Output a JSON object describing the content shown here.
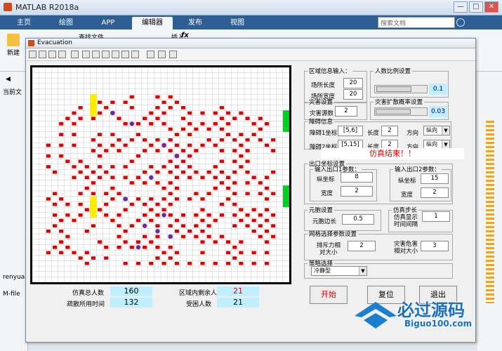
{
  "app": {
    "title": "MATLAB R2018a",
    "window_buttons": [
      "—",
      "□",
      "✕"
    ],
    "tabs": [
      "主页",
      "绘图",
      "APP",
      "编辑器",
      "发布",
      "视图"
    ],
    "active_tab": 3,
    "search_placeholder": "搜索文档",
    "toolbar": {
      "new_label": "新建",
      "find_files": "查找文件",
      "insert_label": "插入",
      "fx": "fx"
    },
    "left_labels": {
      "current_folder": "当前文",
      "workspace": "renyua",
      "mfile": "M-file"
    }
  },
  "figure": {
    "title": "Evacuation",
    "left_info": {
      "total_people_label": "仿真总人数",
      "total_people": "160",
      "time_label": "疏散所用时间",
      "time": "132",
      "remaining_label": "区域内剩余人数",
      "remaining": "21",
      "trapped_label": "受困人数",
      "trapped": "21"
    },
    "area": {
      "legend": "区域信息输入：",
      "len_label": "场所长度",
      "len": "20",
      "wid_label": "场所宽度",
      "wid": "20"
    },
    "ratio": {
      "legend": "人数比例设置",
      "value": "0.1",
      "level": 0.1
    },
    "disaster": {
      "legend": "灾害设置",
      "src_label": "灾害源数",
      "src": "2"
    },
    "spread": {
      "legend": "灾害扩散概率设置",
      "value": "0.03",
      "level": 0.03
    },
    "obstacle": {
      "legend": "障碍信息",
      "rows": [
        {
          "label": "障碍1坐标",
          "coord": "[5,6]",
          "len_label": "长度",
          "len": "2",
          "dir_label": "方向",
          "dir": "纵向"
        },
        {
          "label": "障碍2坐标",
          "coord": "[5,15]",
          "len_label": "长度",
          "len": "2",
          "dir_label": "方向",
          "dir": "纵向"
        }
      ]
    },
    "sim_end": "仿真结束！！",
    "exit": {
      "legend": "出口坐标设置",
      "e1_title": "输入出口1参数：",
      "e1_y_label": "纵坐标",
      "e1_y": "8",
      "e1_w_label": "宽度",
      "e1_w": "2",
      "e2_title": "输入出口2参数：",
      "e2_y_label": "纵坐标",
      "e2_y": "15",
      "e2_w_label": "宽度",
      "e2_w": "2"
    },
    "cell": {
      "legend": "元胞设置",
      "side_label": "元胞边长",
      "side": "0.5"
    },
    "step": {
      "legend": "仿真步长",
      "interval_label_1": "仿真显示",
      "interval_label_2": "时间间隔",
      "interval": "1"
    },
    "field": {
      "legend": "网格选择参数设置",
      "rep_label_1": "排斥力相",
      "rep_label_2": "对大小",
      "rep": "2",
      "haz_label_1": "灾害危害",
      "haz_label_2": "相对大小",
      "haz": "3"
    },
    "strategy": {
      "legend": "策略选择",
      "value": "冷静型"
    },
    "buttons": {
      "start": "开始",
      "reset": "复位",
      "exit": "退出"
    }
  },
  "watermark": {
    "brand": "必过源码",
    "url": "Biguo100.com"
  },
  "colors": {
    "person": "#e00000",
    "hazard": "#6a2aa0",
    "obstacle": "#ffee00",
    "exit": "#00d020",
    "accent": "#2d5f95"
  }
}
